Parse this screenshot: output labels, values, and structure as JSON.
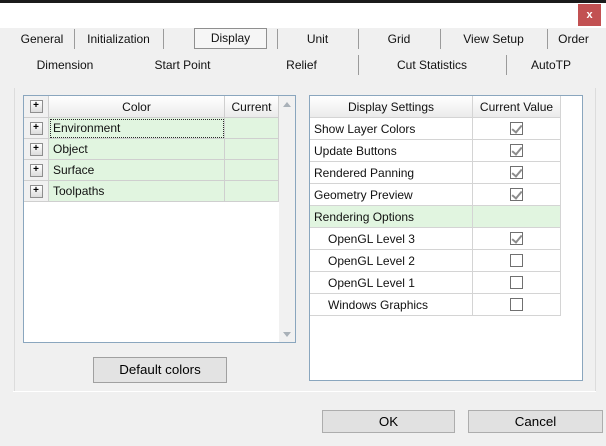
{
  "window": {
    "close": "x"
  },
  "tabs": {
    "active": "Display",
    "row1": [
      "General",
      "Initialization",
      "Display",
      "Unit",
      "Grid",
      "View Setup",
      "Order"
    ],
    "row2": [
      "Dimension",
      "Start Point",
      "Relief",
      "Cut Statistics",
      "AutoTP"
    ]
  },
  "color_table": {
    "header_color": "Color",
    "header_current": "Current",
    "expand_glyph": "+",
    "rows": [
      {
        "label": "Environment",
        "current": "",
        "focused": true
      },
      {
        "label": "Object",
        "current": "",
        "focused": false
      },
      {
        "label": "Surface",
        "current": "",
        "focused": false
      },
      {
        "label": "Toolpaths",
        "current": "",
        "focused": false
      }
    ]
  },
  "settings_table": {
    "header_setting": "Display Settings",
    "header_value": "Current Value",
    "rows": [
      {
        "label": "Show Layer Colors",
        "type": "checkbox",
        "checked": true
      },
      {
        "label": "Update Buttons",
        "type": "checkbox",
        "checked": true
      },
      {
        "label": "Rendered Panning",
        "type": "checkbox",
        "checked": true
      },
      {
        "label": "Geometry Preview",
        "type": "checkbox",
        "checked": true
      },
      {
        "label": "Rendering Options",
        "type": "section",
        "checked": false
      },
      {
        "label": "OpenGL Level 3",
        "type": "checkbox",
        "checked": true,
        "indent": true
      },
      {
        "label": "OpenGL Level 2",
        "type": "checkbox",
        "checked": false,
        "indent": true
      },
      {
        "label": "OpenGL Level 1",
        "type": "checkbox",
        "checked": false,
        "indent": true
      },
      {
        "label": "Windows Graphics",
        "type": "checkbox",
        "checked": false,
        "indent": true
      }
    ]
  },
  "buttons": {
    "default_colors": "Default colors",
    "ok": "OK",
    "cancel": "Cancel"
  },
  "icons": {
    "close": "x-glyph",
    "expand": "plus-box",
    "scroll_up": "triangle-up",
    "scroll_down": "triangle-down",
    "checked": "gray-checkmark"
  },
  "colors": {
    "row_green": "#e1f5e0",
    "panel_border": "#8aa6be",
    "close_red": "#c25152",
    "check": "#8c8c8c",
    "divider": "#a5a5a5"
  }
}
